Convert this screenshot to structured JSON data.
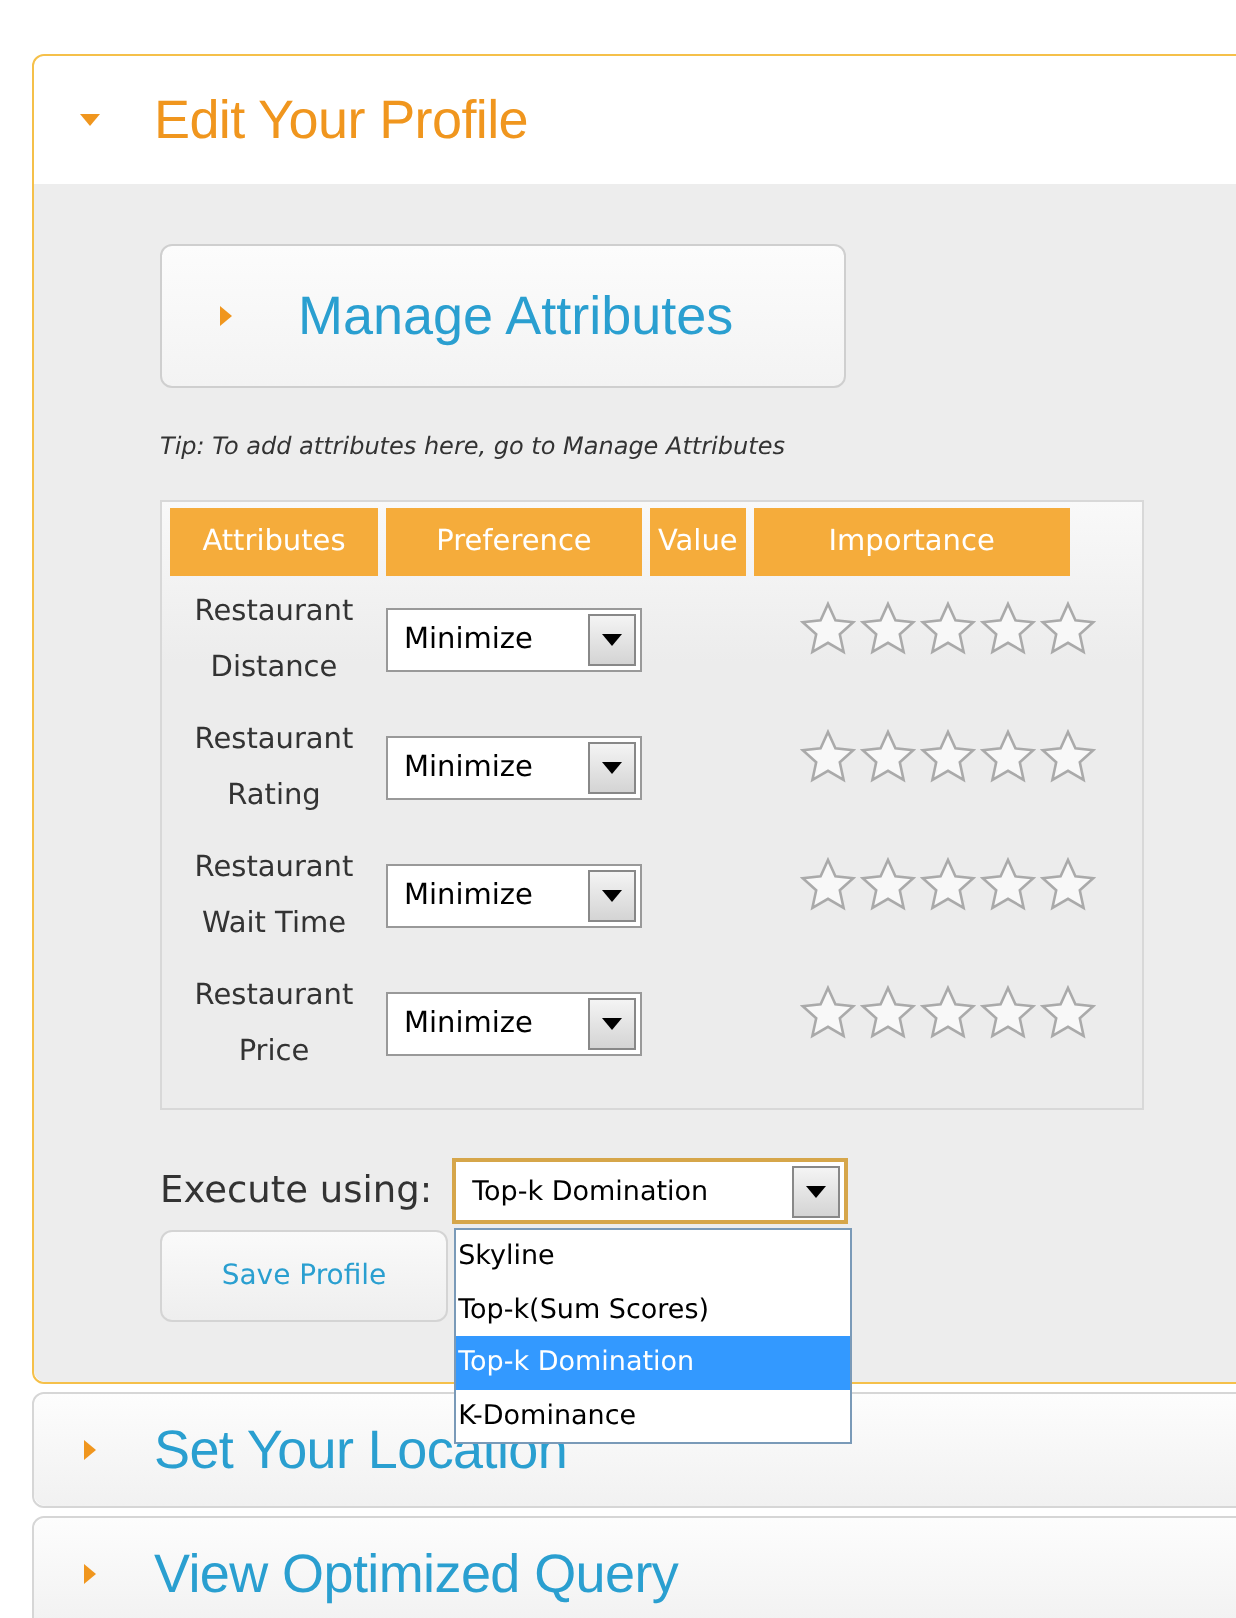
{
  "sections": [
    {
      "title": "Edit Your Profile",
      "expanded": true
    },
    {
      "title": "Set Your Location",
      "expanded": false
    },
    {
      "title": "View Optimized Query",
      "expanded": false
    }
  ],
  "manage_attributes": {
    "title": "Manage Attributes",
    "expanded": false
  },
  "tip": "Tip: To add attributes here, go to Manage Attributes",
  "table": {
    "columns": [
      "Attributes",
      "Preference",
      "Value",
      "Importance"
    ],
    "rows": [
      {
        "attribute": "Restaurant Distance",
        "preference": "Minimize",
        "stars": 0
      },
      {
        "attribute": "Restaurant Rating",
        "preference": "Minimize",
        "stars": 0
      },
      {
        "attribute": "Restaurant Wait Time",
        "preference": "Minimize",
        "stars": 0
      },
      {
        "attribute": "Restaurant Price",
        "preference": "Minimize",
        "stars": 0
      }
    ]
  },
  "execute": {
    "label": "Execute using:",
    "value": "Top-k Domination",
    "open": true,
    "options": [
      {
        "label": "Skyline",
        "selected": false
      },
      {
        "label": "Top-k(Sum Scores)",
        "selected": false
      },
      {
        "label": "Top-k Domination",
        "selected": true
      },
      {
        "label": "K-Dominance",
        "selected": false
      }
    ]
  },
  "save_button": "Save Profile"
}
